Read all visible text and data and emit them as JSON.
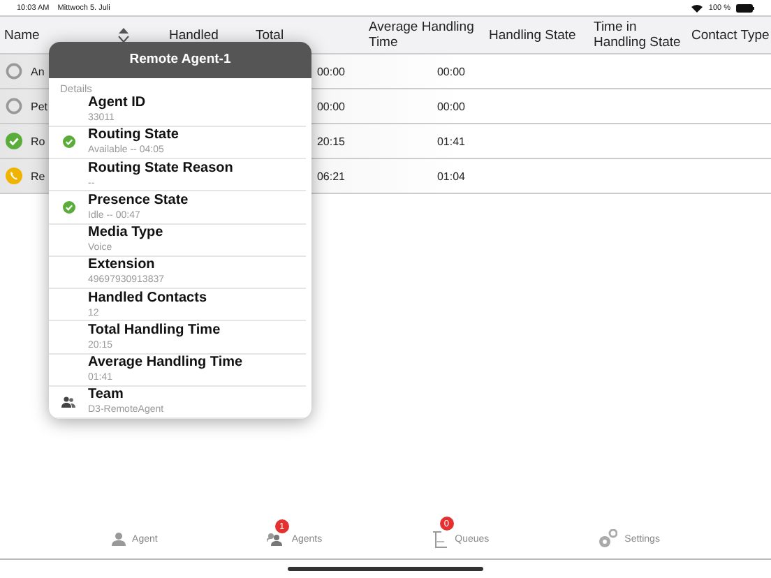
{
  "status_bar": {
    "time": "10:03 AM",
    "date": "Mittwoch 5. Juli",
    "battery": "100 %"
  },
  "table": {
    "columns": [
      "Name",
      "Handled",
      "Total",
      "Average Handling Time",
      "Handling State",
      "Time in Handling State",
      "Contact Type"
    ],
    "rows": [
      {
        "kind": "offline",
        "name": "An",
        "total_handling_time": "00:00",
        "average_handling_time": "00:00"
      },
      {
        "kind": "offline",
        "name": "Pet",
        "total_handling_time": "00:00",
        "average_handling_time": "00:00"
      },
      {
        "kind": "available",
        "name": "Ro",
        "total_handling_time": "20:15",
        "average_handling_time": "01:41"
      },
      {
        "kind": "on_call",
        "name": "Re",
        "total_handling_time": "06:21",
        "average_handling_time": "01:04"
      }
    ]
  },
  "popover": {
    "title": "Remote Agent-1",
    "section": "Details",
    "items": [
      {
        "kind": "plain",
        "label": "Agent ID",
        "value": "33011"
      },
      {
        "kind": "check",
        "label": "Routing State",
        "value": "Available -- 04:05"
      },
      {
        "kind": "plain",
        "label": "Routing State Reason",
        "value": "--"
      },
      {
        "kind": "check",
        "label": "Presence State",
        "value": "Idle -- 00:47"
      },
      {
        "kind": "plain",
        "label": "Media Type",
        "value": "Voice"
      },
      {
        "kind": "plain",
        "label": "Extension",
        "value": "49697930913837"
      },
      {
        "kind": "plain",
        "label": "Handled Contacts",
        "value": "12"
      },
      {
        "kind": "plain",
        "label": "Total Handling Time",
        "value": "20:15"
      },
      {
        "kind": "plain",
        "label": "Average Handling Time",
        "value": "01:41"
      },
      {
        "kind": "team",
        "label": "Team",
        "value": "D3-RemoteAgent"
      }
    ]
  },
  "tab_bar": [
    {
      "kind": "agent",
      "label": "Agent",
      "selected": false
    },
    {
      "kind": "agents",
      "label": "Agents",
      "badge": "1",
      "selected": false
    },
    {
      "kind": "queues",
      "label": "Queues",
      "badge": "0",
      "selected": false
    },
    {
      "kind": "settings",
      "label": "Settings",
      "selected": false
    }
  ]
}
